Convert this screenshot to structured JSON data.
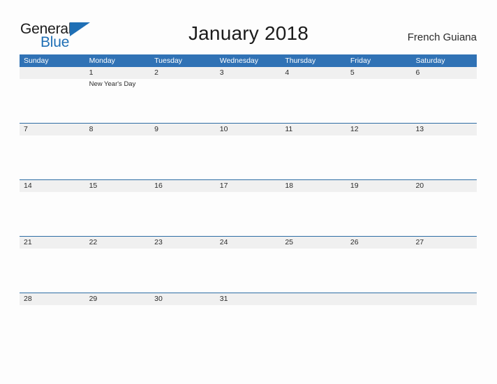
{
  "brand": {
    "name_part1": "General",
    "name_part2": "Blue",
    "triangle_icon": "triangle-logo-icon",
    "accent_color": "#1f6fb5"
  },
  "header": {
    "title": "January 2018",
    "locale": "French Guiana"
  },
  "calendar": {
    "header_bg_color": "#3072b5",
    "band_bg_color": "#f0f0f0",
    "rule_color": "#2e6da4",
    "weekdays": [
      "Sunday",
      "Monday",
      "Tuesday",
      "Wednesday",
      "Thursday",
      "Friday",
      "Saturday"
    ],
    "weeks": [
      {
        "days": [
          {
            "num": "",
            "events": []
          },
          {
            "num": "1",
            "events": [
              "New Year's Day"
            ]
          },
          {
            "num": "2",
            "events": []
          },
          {
            "num": "3",
            "events": []
          },
          {
            "num": "4",
            "events": []
          },
          {
            "num": "5",
            "events": []
          },
          {
            "num": "6",
            "events": []
          }
        ]
      },
      {
        "days": [
          {
            "num": "7",
            "events": []
          },
          {
            "num": "8",
            "events": []
          },
          {
            "num": "9",
            "events": []
          },
          {
            "num": "10",
            "events": []
          },
          {
            "num": "11",
            "events": []
          },
          {
            "num": "12",
            "events": []
          },
          {
            "num": "13",
            "events": []
          }
        ]
      },
      {
        "days": [
          {
            "num": "14",
            "events": []
          },
          {
            "num": "15",
            "events": []
          },
          {
            "num": "16",
            "events": []
          },
          {
            "num": "17",
            "events": []
          },
          {
            "num": "18",
            "events": []
          },
          {
            "num": "19",
            "events": []
          },
          {
            "num": "20",
            "events": []
          }
        ]
      },
      {
        "days": [
          {
            "num": "21",
            "events": []
          },
          {
            "num": "22",
            "events": []
          },
          {
            "num": "23",
            "events": []
          },
          {
            "num": "24",
            "events": []
          },
          {
            "num": "25",
            "events": []
          },
          {
            "num": "26",
            "events": []
          },
          {
            "num": "27",
            "events": []
          }
        ]
      },
      {
        "days": [
          {
            "num": "28",
            "events": []
          },
          {
            "num": "29",
            "events": []
          },
          {
            "num": "30",
            "events": []
          },
          {
            "num": "31",
            "events": []
          },
          {
            "num": "",
            "events": []
          },
          {
            "num": "",
            "events": []
          },
          {
            "num": "",
            "events": []
          }
        ]
      }
    ]
  }
}
